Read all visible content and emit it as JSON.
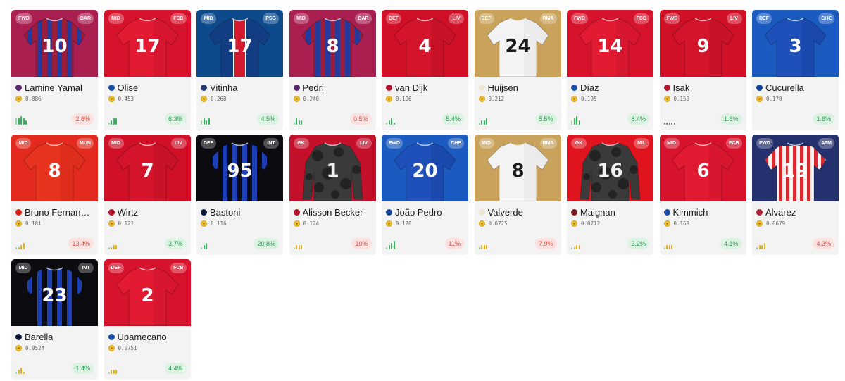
{
  "cards": [
    {
      "pos": "FWD",
      "club": "BAR",
      "number": "10",
      "name": "Lamine Yamal",
      "price": "0.886",
      "change": "2.6%",
      "trend": "down",
      "bg": "#a91f4f",
      "shirt": "stripes",
      "c1": "#243a9c",
      "c2": "#9b1d3a",
      "text": "#ffffff",
      "dot": "#5b2a6e",
      "bars": [
        3,
        3,
        4,
        3,
        2
      ],
      "barcolor": "#35b25a"
    },
    {
      "pos": "MID",
      "club": "FCB",
      "number": "17",
      "name": "Olise",
      "price": "0.453",
      "change": "6.3%",
      "trend": "up",
      "bg": "#d6132c",
      "shirt": "solid",
      "c1": "#e21b33",
      "c2": "#c4102a",
      "text": "#ffffff",
      "dot": "#1b4fa6",
      "bars": [
        1,
        2,
        3,
        3
      ],
      "barcolor": "#35b25a"
    },
    {
      "pos": "MID",
      "club": "PSG",
      "number": "17",
      "name": "Vitinha",
      "price": "0.268",
      "change": "4.5%",
      "trend": "up",
      "bg": "#0d4a8c",
      "shirt": "psg",
      "c1": "#123d82",
      "c2": "#d31a2f",
      "text": "#ffffff",
      "dot": "#233a74",
      "bars": [
        2,
        3,
        2,
        3
      ],
      "barcolor": "#35b25a"
    },
    {
      "pos": "MID",
      "club": "BAR",
      "number": "8",
      "name": "Pedri",
      "price": "0.240",
      "change": "0.5%",
      "trend": "down",
      "bg": "#a91f4f",
      "shirt": "stripes",
      "c1": "#243a9c",
      "c2": "#9b1d3a",
      "text": "#ffffff",
      "dot": "#5b2a6e",
      "bars": [
        1,
        3,
        2,
        2
      ],
      "barcolor": "#35b25a"
    },
    {
      "pos": "DEF",
      "club": "LIV",
      "number": "4",
      "name": "van Dijk",
      "price": "0.196",
      "change": "5.4%",
      "trend": "up",
      "bg": "#cf1026",
      "shirt": "solid",
      "c1": "#d3142b",
      "c2": "#b30d22",
      "text": "#ffffff",
      "dot": "#b3122b",
      "bars": [
        1,
        2,
        3,
        1
      ],
      "barcolor": "#35b25a"
    },
    {
      "pos": "DEF",
      "club": "RMA",
      "number": "24",
      "name": "Huijsen",
      "price": "0.212",
      "change": "5.5%",
      "trend": "up",
      "bg": "#c9a35c",
      "shirt": "solid",
      "c1": "#f3f3f3",
      "c2": "#dcdcdc",
      "text": "#1a1a1a",
      "dot": "#efe6d0",
      "bars": [
        1,
        2,
        2,
        3
      ],
      "barcolor": "#35b25a"
    },
    {
      "pos": "FWD",
      "club": "FCB",
      "number": "14",
      "name": "Díaz",
      "price": "0.195",
      "change": "8.4%",
      "trend": "up",
      "bg": "#d6132c",
      "shirt": "solid",
      "c1": "#e21b33",
      "c2": "#c4102a",
      "text": "#ffffff",
      "dot": "#1b4fa6",
      "bars": [
        2,
        3,
        4,
        2
      ],
      "barcolor": "#35b25a"
    },
    {
      "pos": "FWD",
      "club": "LIV",
      "number": "9",
      "name": "Isak",
      "price": "0.150",
      "change": "1.6%",
      "trend": "up",
      "bg": "#cf1026",
      "shirt": "solid",
      "c1": "#d3142b",
      "c2": "#b30d22",
      "text": "#ffffff",
      "dot": "#b3122b",
      "bars": [
        1,
        1,
        1,
        1,
        1
      ],
      "barcolor": "#777777"
    },
    {
      "pos": "DEF",
      "club": "CHE",
      "number": "3",
      "name": "Cucurella",
      "price": "0.170",
      "change": "1.6%",
      "trend": "up",
      "bg": "#1b5bc0",
      "shirt": "solid",
      "c1": "#1f4fb8",
      "c2": "#123b94",
      "text": "#ffffff",
      "dot": "#14449a",
      "bars": [],
      "barcolor": "#35b25a"
    },
    {
      "pos": "MID",
      "club": "MUN",
      "number": "8",
      "name": "Bruno Fernan…",
      "price": "0.181",
      "change": "13.4%",
      "trend": "down",
      "bg": "#e22a1e",
      "shirt": "solid",
      "c1": "#e8341f",
      "c2": "#cc2414",
      "text": "#ffffff",
      "dot": "#d8291c",
      "bars": [
        1,
        1,
        2,
        3
      ],
      "barcolor": "#e2b021"
    },
    {
      "pos": "MID",
      "club": "LIV",
      "number": "7",
      "name": "Wirtz",
      "price": "0.121",
      "change": "3.7%",
      "trend": "up",
      "bg": "#cf1026",
      "shirt": "solid",
      "c1": "#d3142b",
      "c2": "#b30d22",
      "text": "#ffffff",
      "dot": "#b3122b",
      "bars": [
        1,
        1,
        2,
        2
      ],
      "barcolor": "#e2b021"
    },
    {
      "pos": "DEF",
      "club": "INT",
      "number": "95",
      "name": "Bastoni",
      "price": "0.116",
      "change": "20.8%",
      "trend": "up",
      "bg": "#0c0c10",
      "shirt": "stripes",
      "c1": "#1d3fb5",
      "c2": "#0b0b14",
      "text": "#ffffff",
      "dot": "#0b1a3a",
      "bars": [
        1,
        2,
        3
      ],
      "barcolor": "#35b25a"
    },
    {
      "pos": "GK",
      "club": "LIV",
      "number": "1",
      "name": "Alisson Becker",
      "price": "0.124",
      "change": "10%",
      "trend": "down",
      "bg": "#c4102a",
      "shirt": "camo",
      "c1": "#3a3a3a",
      "c2": "#232323",
      "text": "#f1f1f1",
      "dot": "#b3122b",
      "bars": [
        1,
        2,
        2,
        2
      ],
      "barcolor": "#e2b021"
    },
    {
      "pos": "FWD",
      "club": "CHE",
      "number": "20",
      "name": "João Pedro",
      "price": "0.120",
      "change": "11%",
      "trend": "down",
      "bg": "#1b5bc0",
      "shirt": "solid",
      "c1": "#1f4fb8",
      "c2": "#123b94",
      "text": "#ffffff",
      "dot": "#14449a",
      "bars": [
        1,
        2,
        3,
        4
      ],
      "barcolor": "#35b25a"
    },
    {
      "pos": "MID",
      "club": "RMA",
      "number": "8",
      "name": "Valverde",
      "price": "0.0725",
      "change": "7.9%",
      "trend": "down",
      "bg": "#c9a35c",
      "shirt": "solid",
      "c1": "#f3f3f3",
      "c2": "#dcdcdc",
      "text": "#1a1a1a",
      "dot": "#efe6d0",
      "bars": [
        1,
        2,
        2,
        2
      ],
      "barcolor": "#e2b021"
    },
    {
      "pos": "GK",
      "club": "MIL",
      "number": "16",
      "name": "Maignan",
      "price": "0.0712",
      "change": "3.2%",
      "trend": "up",
      "bg": "#e0141f",
      "shirt": "camo",
      "c1": "#3a3a3a",
      "c2": "#232323",
      "text": "#f1f1f1",
      "dot": "#7a1a22",
      "bars": [
        1,
        1,
        2,
        2
      ],
      "barcolor": "#e2b021"
    },
    {
      "pos": "MID",
      "club": "FCB",
      "number": "6",
      "name": "Kimmich",
      "price": "0.160",
      "change": "4.1%",
      "trend": "up",
      "bg": "#d6132c",
      "shirt": "solid",
      "c1": "#e21b33",
      "c2": "#c4102a",
      "text": "#ffffff",
      "dot": "#1b4fa6",
      "bars": [
        1,
        2,
        2,
        2
      ],
      "barcolor": "#e2b021"
    },
    {
      "pos": "FWD",
      "club": "ATM",
      "number": "19",
      "name": "Alvarez",
      "price": "0.0679",
      "change": "4.3%",
      "trend": "down",
      "bg": "#25306e",
      "shirt": "redwhite",
      "c1": "#d82a30",
      "c2": "#f4f4f4",
      "text": "#ffffff",
      "dot": "#b0283a",
      "bars": [
        1,
        2,
        2,
        3
      ],
      "barcolor": "#e2b021"
    },
    {
      "pos": "MID",
      "club": "INT",
      "number": "23",
      "name": "Barella",
      "price": "0.0524",
      "change": "1.4%",
      "trend": "up",
      "bg": "#0c0c10",
      "shirt": "stripes",
      "c1": "#1d3fb5",
      "c2": "#0b0b14",
      "text": "#ffffff",
      "dot": "#0b1a3a",
      "bars": [
        1,
        2,
        3,
        1
      ],
      "barcolor": "#e2b021"
    },
    {
      "pos": "DEF",
      "club": "FCB",
      "number": "2",
      "name": "Upamecano",
      "price": "0.0751",
      "change": "4.4%",
      "trend": "up",
      "bg": "#d6132c",
      "shirt": "solid",
      "c1": "#e21b33",
      "c2": "#c4102a",
      "text": "#ffffff",
      "dot": "#1b4fa6",
      "bars": [
        1,
        2,
        2,
        2
      ],
      "barcolor": "#e2b021"
    }
  ]
}
